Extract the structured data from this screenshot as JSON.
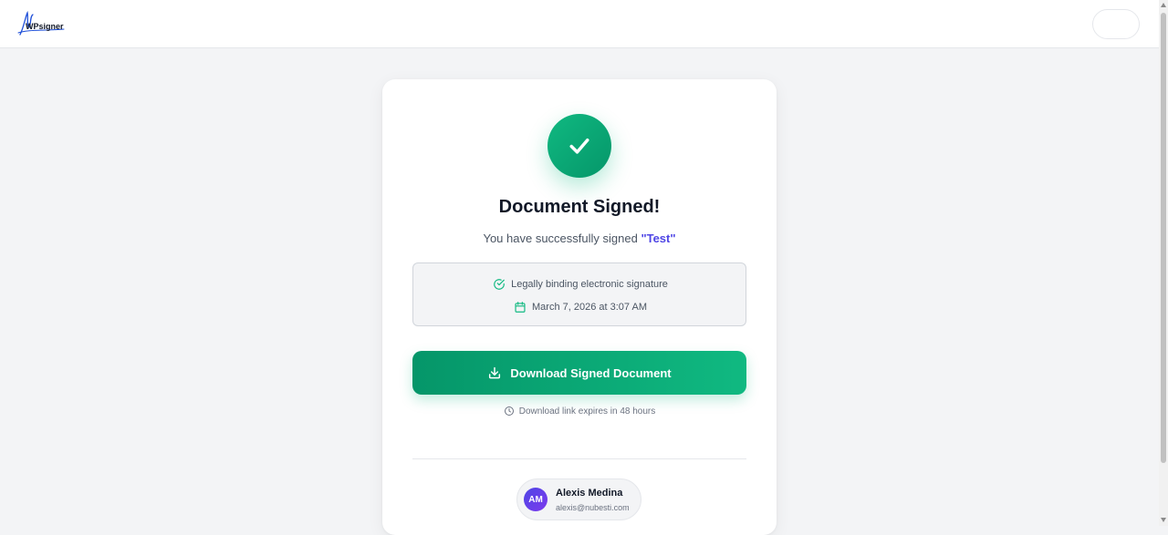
{
  "header": {
    "logo_text": "WPsigner"
  },
  "card": {
    "title": "Document Signed!",
    "subtitle_prefix": "You have successfully signed ",
    "document_name": "\"Test\"",
    "info": {
      "signature_note": "Legally binding electronic signature",
      "signed_date": "March 7, 2026 at 3:07 AM"
    },
    "download_label": "Download Signed Document",
    "expiry_note": "Download link expires in 48 hours",
    "user": {
      "initials": "AM",
      "name": "Alexis Medina",
      "email": "alexis@nubesti.com"
    }
  },
  "colors": {
    "accent_green": "#10b981",
    "accent_green_dark": "#059669",
    "link_purple": "#4f46e5",
    "avatar_purple": "#6d28d9"
  },
  "icons": {
    "success": "check-icon",
    "signature": "circle-check-icon",
    "date": "calendar-icon",
    "download": "download-icon",
    "expiry": "clock-icon"
  }
}
